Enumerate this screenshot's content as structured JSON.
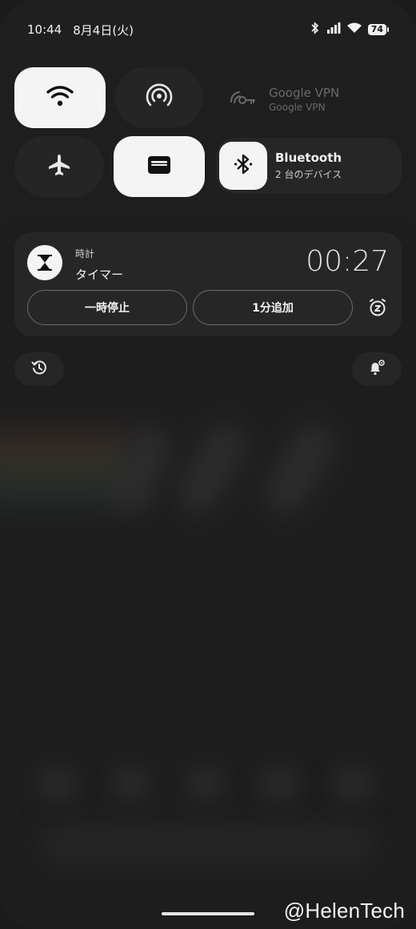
{
  "status_bar": {
    "time": "10:44",
    "date": "8月4日(火)",
    "battery_level": "74"
  },
  "quick_settings": {
    "vpn": {
      "title": "Google VPN",
      "subtitle": "Google VPN"
    },
    "bluetooth": {
      "title": "Bluetooth",
      "subtitle": "2 台のデバイス"
    }
  },
  "notification": {
    "app": "時計",
    "label": "タイマー",
    "timer": "00:27",
    "pause_label": "一時停止",
    "add_minute_label": "1分追加"
  },
  "watermark": "@HelenTech",
  "colors": {
    "tile_on": "#f4f4f4",
    "tile_off": "#252525",
    "background": "#1b1b1b"
  }
}
